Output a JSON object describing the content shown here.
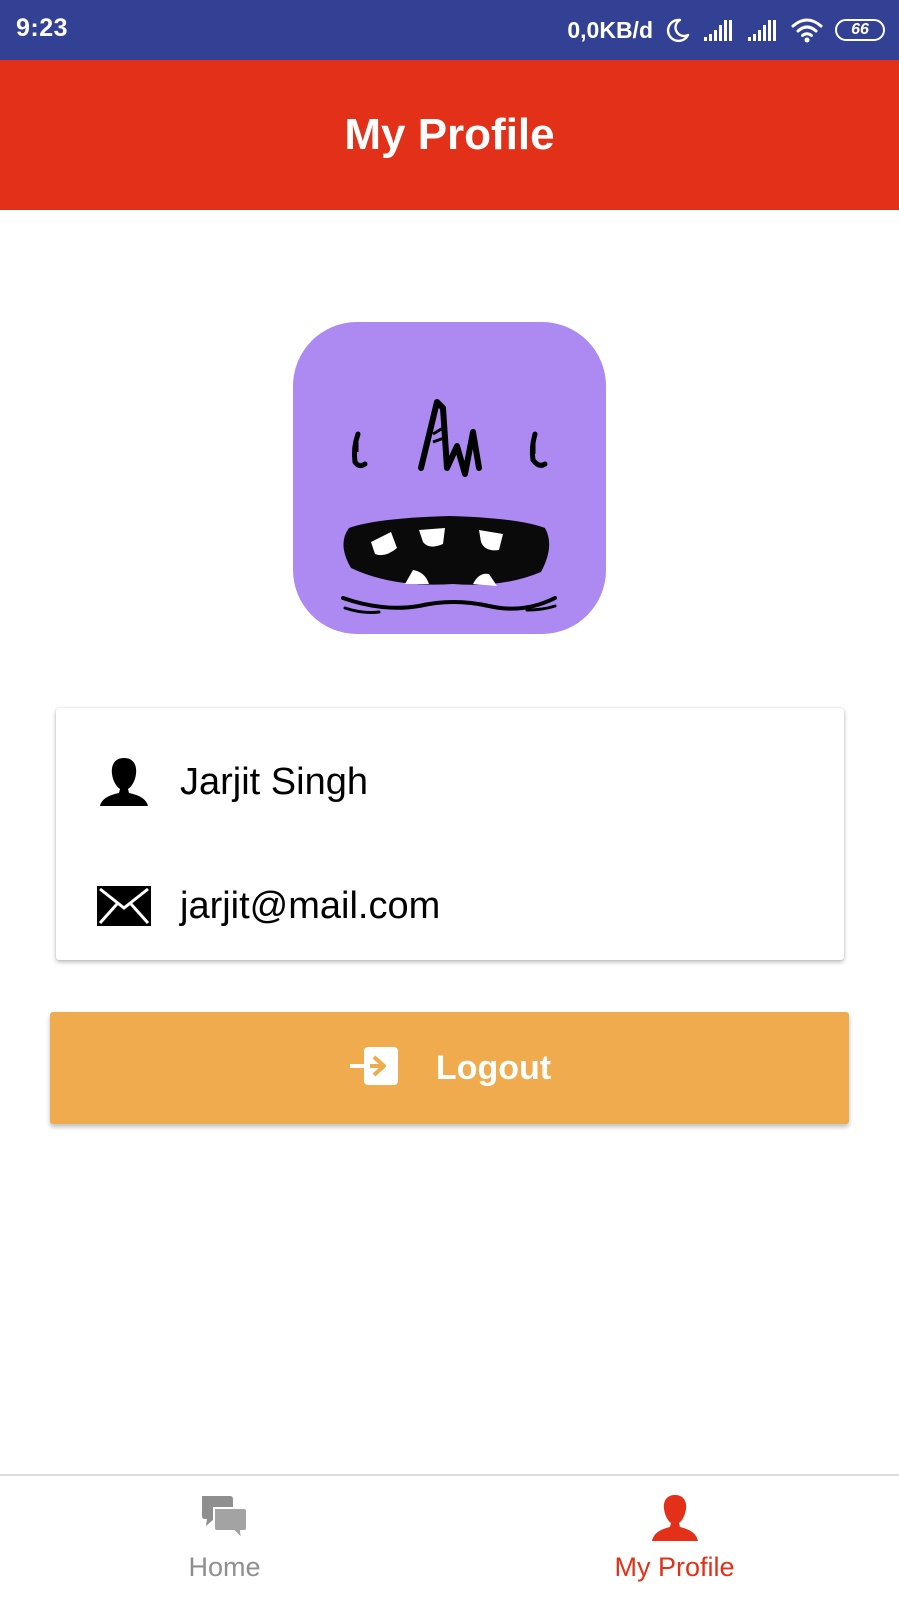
{
  "status_bar": {
    "time": "9:23",
    "network_speed": "0,0KB/d",
    "battery_level": "66",
    "icons": [
      "moon-icon",
      "signal-icon",
      "signal-icon",
      "wifi-icon",
      "battery-icon"
    ]
  },
  "app_bar": {
    "title": "My Profile"
  },
  "profile": {
    "avatar_icon": "monster-face-avatar",
    "name": "Jarjit Singh",
    "name_icon": "user-icon",
    "email": "jarjit@mail.com",
    "email_icon": "envelope-icon"
  },
  "logout_button": {
    "label": "Logout",
    "icon": "login-arrow-icon"
  },
  "bottom_nav": {
    "items": [
      {
        "label": "Home",
        "icon": "chat-bubbles-icon",
        "active": false
      },
      {
        "label": "My Profile",
        "icon": "user-icon",
        "active": true
      }
    ]
  },
  "colors": {
    "status_bar": "#324193",
    "app_bar": "#e33019",
    "avatar_bg": "#ac8af1",
    "logout_button": "#efab4d",
    "nav_active": "#e33019",
    "nav_inactive": "#8f8f8f"
  }
}
